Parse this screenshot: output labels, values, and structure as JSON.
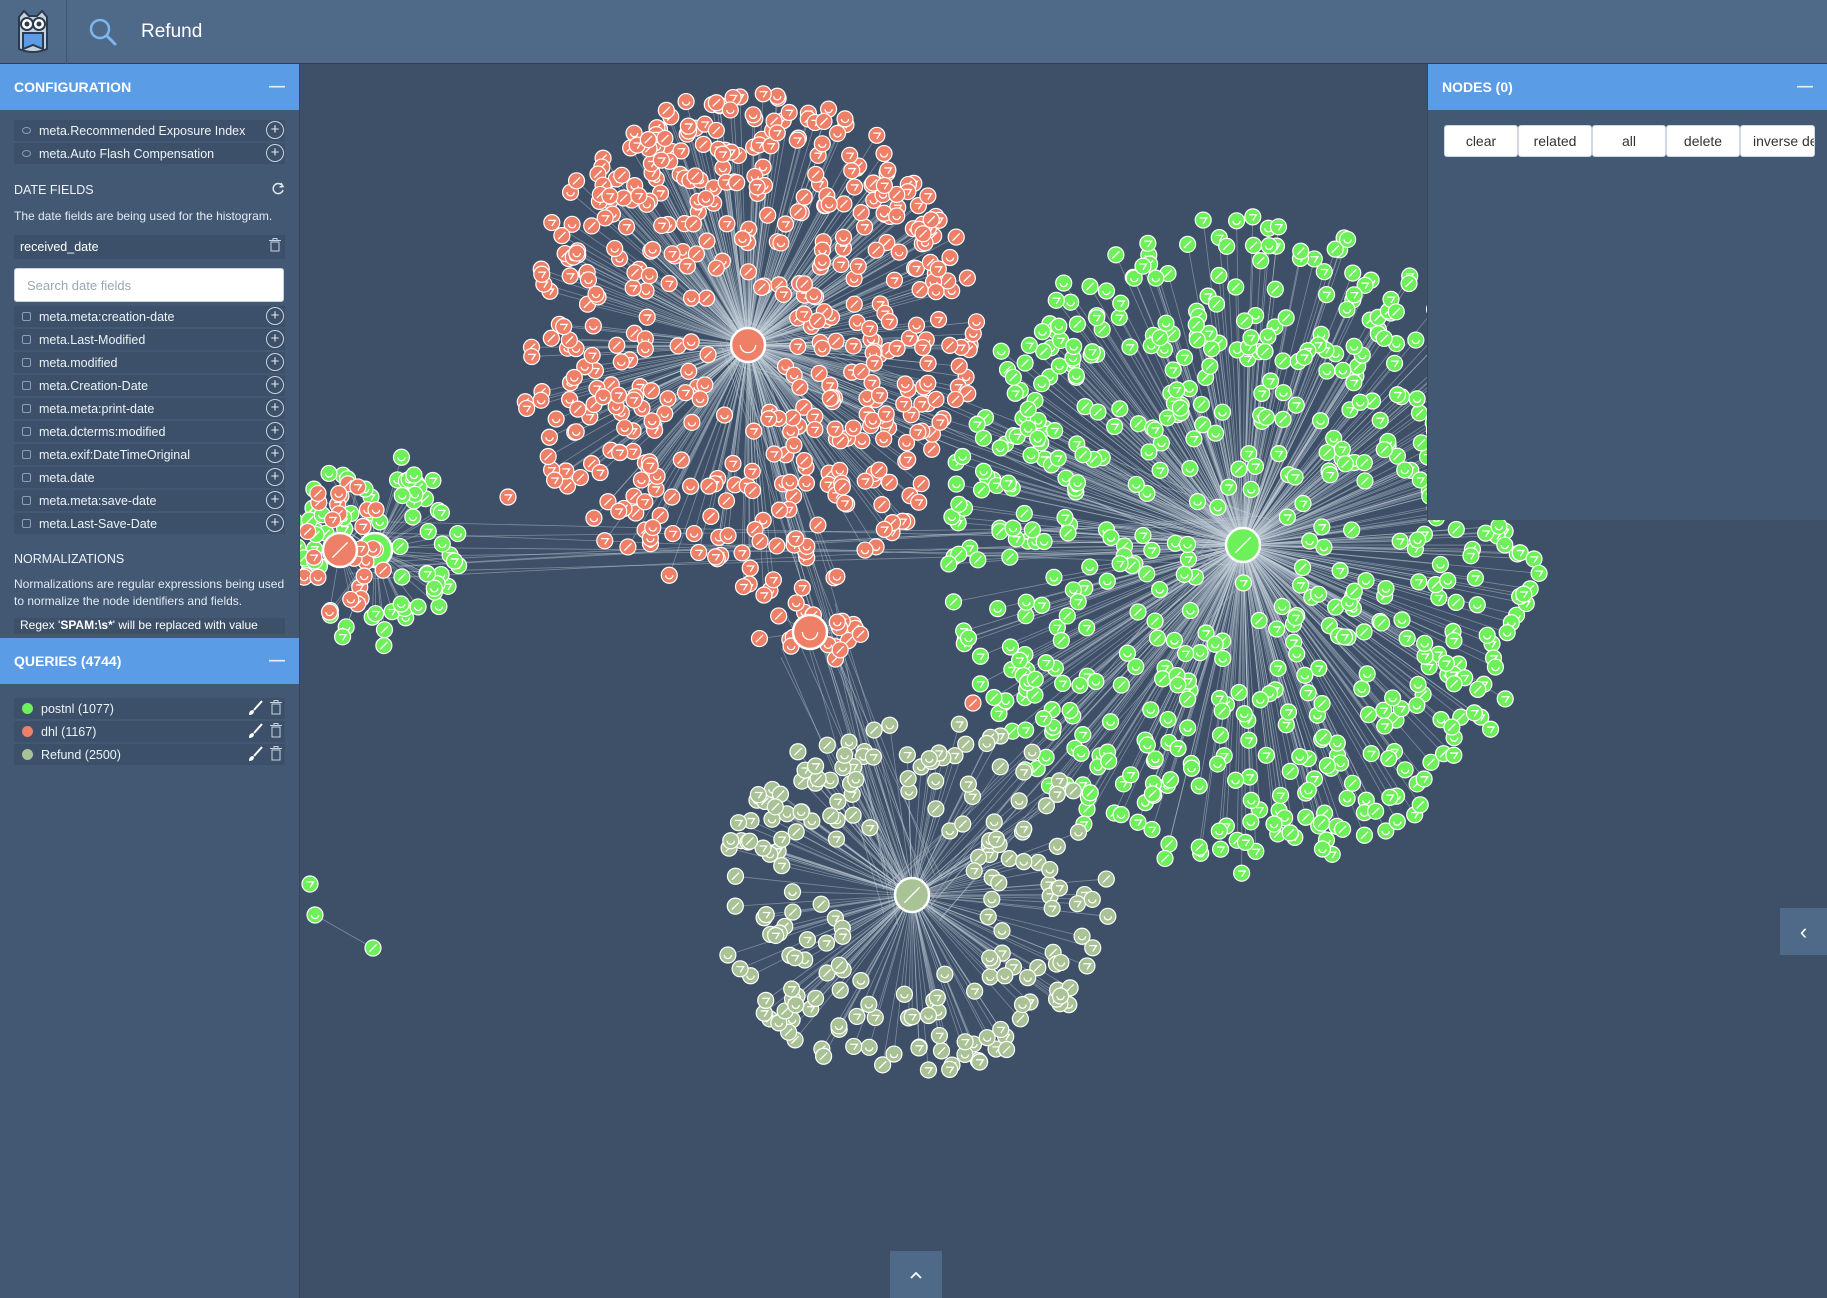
{
  "app": {
    "search_value": "Refund"
  },
  "configuration": {
    "title": "CONFIGURATION",
    "collapse": "—",
    "meta_fields": [
      {
        "label": "meta.Recommended Exposure Index"
      },
      {
        "label": "meta.Auto Flash Compensation"
      }
    ],
    "date_fields": {
      "title": "DATE FIELDS",
      "description": "The date fields are being used for the histogram.",
      "selected": "received_date",
      "search_placeholder": "Search date fields",
      "items": [
        {
          "label": "meta.meta:creation-date"
        },
        {
          "label": "meta.Last-Modified"
        },
        {
          "label": "meta.modified"
        },
        {
          "label": "meta.Creation-Date"
        },
        {
          "label": "meta.meta:print-date"
        },
        {
          "label": "meta.dcterms:modified"
        },
        {
          "label": "meta.exif:DateTimeOriginal"
        },
        {
          "label": "meta.date"
        },
        {
          "label": "meta.meta:save-date"
        },
        {
          "label": "meta.Last-Save-Date"
        }
      ]
    },
    "normalizations": {
      "title": "NORMALIZATIONS",
      "description": "Normalizations are regular expressions being used to normalize the node identifiers and fields.",
      "regex_prefix": "Regex '",
      "regex_value": "SPAM:\\s*",
      "regex_suffix": "' will be replaced with value"
    }
  },
  "queries": {
    "title": "QUERIES (4744)",
    "collapse": "—",
    "items": [
      {
        "label": "postnl (1077)",
        "color": "#6ef05a"
      },
      {
        "label": "dhl (1167)",
        "color": "#ee8068"
      },
      {
        "label": "Refund (2500)",
        "color": "#a9c296"
      }
    ]
  },
  "nodes_panel": {
    "title": "NODES (0)",
    "collapse": "—",
    "buttons": [
      {
        "label": "clear"
      },
      {
        "label": "related"
      },
      {
        "label": "all"
      },
      {
        "label": "delete"
      },
      {
        "label": "inverse delete"
      }
    ]
  },
  "toggles": {
    "side": "‹",
    "bottom": "^"
  },
  "colors": {
    "postnl": "#6ef05a",
    "dhl": "#ee8068",
    "refund": "#a9c296",
    "panel_header": "#5b9ce6",
    "canvas": "#3e5068"
  }
}
